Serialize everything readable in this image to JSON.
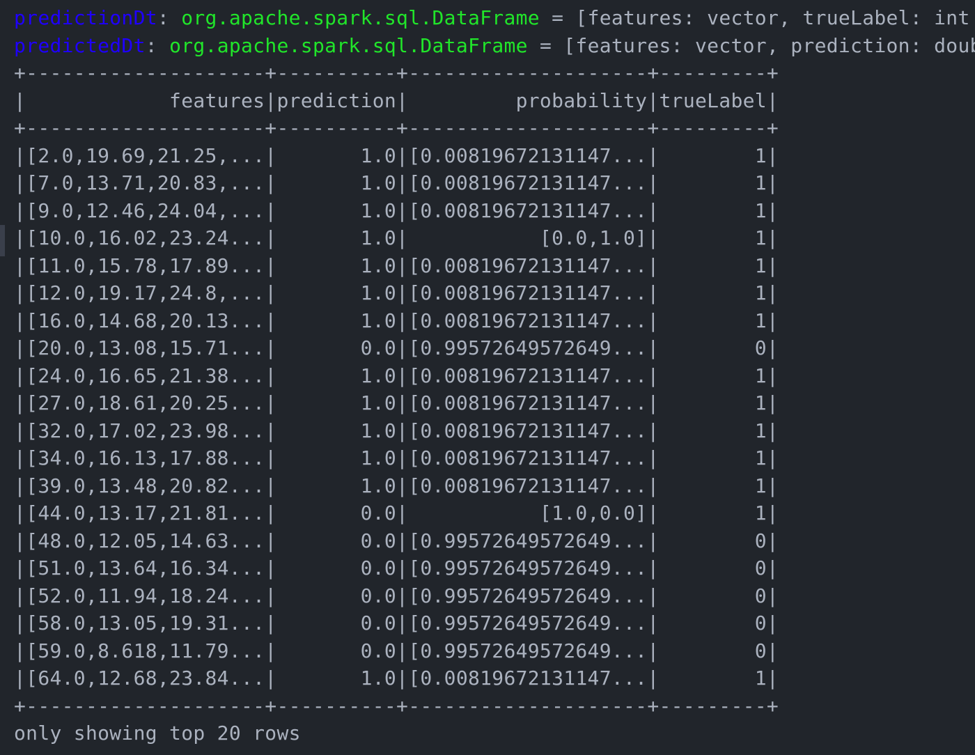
{
  "declarations": [
    {
      "variable": "predictionDt",
      "separator": ": ",
      "type": "org.apache.spark.sql.DataFrame",
      "rest": " = [features: vector, trueLabel: int ..."
    },
    {
      "variable": "predictedDt",
      "separator": ": ",
      "type": "org.apache.spark.sql.DataFrame",
      "rest": " = [features: vector, prediction: double"
    }
  ],
  "table": {
    "top_border": "+--------------------+----------+--------------------+---------+",
    "header": "|            features|prediction|         probability|trueLabel|",
    "header_border": "+--------------------+----------+--------------------+---------+",
    "rows": [
      "|[2.0,19.69,21.25,...|       1.0|[0.00819672131147...|        1|",
      "|[7.0,13.71,20.83,...|       1.0|[0.00819672131147...|        1|",
      "|[9.0,12.46,24.04,...|       1.0|[0.00819672131147...|        1|",
      "|[10.0,16.02,23.24...|       1.0|           [0.0,1.0]|        1|",
      "|[11.0,15.78,17.89...|       1.0|[0.00819672131147...|        1|",
      "|[12.0,19.17,24.8,...|       1.0|[0.00819672131147...|        1|",
      "|[16.0,14.68,20.13...|       1.0|[0.00819672131147...|        1|",
      "|[20.0,13.08,15.71...|       0.0|[0.99572649572649...|        0|",
      "|[24.0,16.65,21.38...|       1.0|[0.00819672131147...|        1|",
      "|[27.0,18.61,20.25...|       1.0|[0.00819672131147...|        1|",
      "|[32.0,17.02,23.98...|       1.0|[0.00819672131147...|        1|",
      "|[34.0,16.13,17.88...|       1.0|[0.00819672131147...|        1|",
      "|[39.0,13.48,20.82...|       1.0|[0.00819672131147...|        1|",
      "|[44.0,13.17,21.81...|       0.0|           [1.0,0.0]|        1|",
      "|[48.0,12.05,14.63...|       0.0|[0.99572649572649...|        0|",
      "|[51.0,13.64,16.34...|       0.0|[0.99572649572649...|        0|",
      "|[52.0,11.94,18.24...|       0.0|[0.99572649572649...|        0|",
      "|[58.0,13.05,19.31...|       0.0|[0.99572649572649...|        0|",
      "|[59.0,8.618,11.79...|       0.0|[0.99572649572649...|        0|",
      "|[64.0,12.68,23.84...|       1.0|[0.00819672131147...|        1|"
    ],
    "bottom_border": "+--------------------+----------+--------------------+---------+"
  },
  "footer": "only showing top 20 rows",
  "colors": {
    "background": "#21252b",
    "variable": "#1f00ff",
    "type": "#21e52a",
    "text": "#abb2bf"
  }
}
